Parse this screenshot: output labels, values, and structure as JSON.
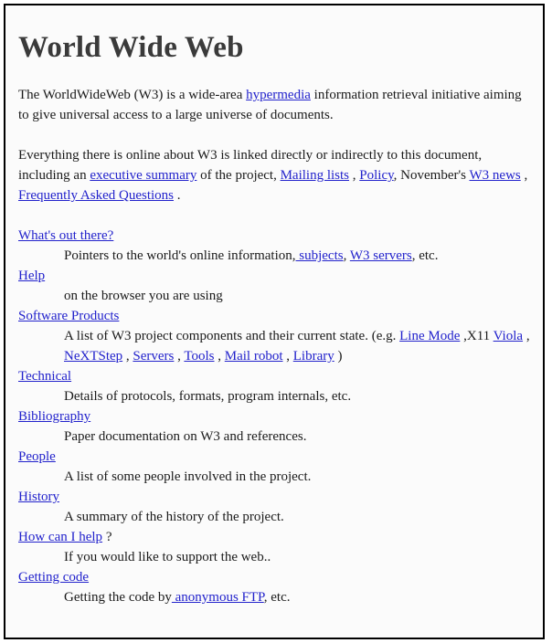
{
  "page": {
    "title": "World Wide Web",
    "intro": {
      "text1": "The WorldWideWeb (W3) is a wide-area ",
      "link_hypermedia": "hypermedia",
      "text2": " information retrieval initiative aiming to give universal access to a large universe of documents."
    },
    "overview": {
      "text1": "Everything there is online about W3 is linked directly or indirectly to this document, including an ",
      "link_summary": "executive summary",
      "text2": " of the project, ",
      "link_mailing": "Mailing lists",
      "sep1": " , ",
      "link_policy": "Policy",
      "text3": ", November's ",
      "link_news": "W3 news",
      "sep2": " , ",
      "link_faq": "Frequently Asked Questions",
      "end": " ."
    },
    "topics": {
      "whats_out_there": {
        "label": "What's out there?",
        "desc1": "Pointers to the world's online information,",
        "link_subjects": " subjects",
        "sep": ", ",
        "link_servers": "W3 servers",
        "desc2": ", etc."
      },
      "help": {
        "label": "Help",
        "desc": "on the browser you are using"
      },
      "software_products": {
        "label": "Software Products",
        "desc1": "A list of W3 project components and their current state. (e.g. ",
        "link_line_mode": "Line Mode",
        "sep1": " ,X11 ",
        "link_viola": "Viola",
        "sep2": " , ",
        "link_nextstep": "NeXTStep",
        "sep3": " , ",
        "link_servers": "Servers",
        "sep4": " , ",
        "link_tools": "Tools",
        "sep5": " , ",
        "link_mail_robot": "Mail robot",
        "sep6": " , ",
        "link_library": "Library",
        "end": " )"
      },
      "technical": {
        "label": "Technical",
        "desc": "Details of protocols, formats, program internals, etc."
      },
      "bibliography": {
        "label": "Bibliography",
        "desc": "Paper documentation on W3 and references."
      },
      "people": {
        "label": "People",
        "desc": "A list of some people involved in the project."
      },
      "history": {
        "label": "History",
        "desc": "A summary of the history of the project."
      },
      "how_can_i_help": {
        "label": "How can I help",
        "suffix": " ?",
        "desc": "If you would like to support the web.."
      },
      "getting_code": {
        "label": "Getting code",
        "desc1": "Getting the code by",
        "link_ftp": " anonymous FTP",
        "desc2": ", etc."
      }
    }
  },
  "colors": {
    "link": "#2222cc",
    "text": "#1a1a1a",
    "heading": "#3a3a3a",
    "border": "#000000"
  }
}
